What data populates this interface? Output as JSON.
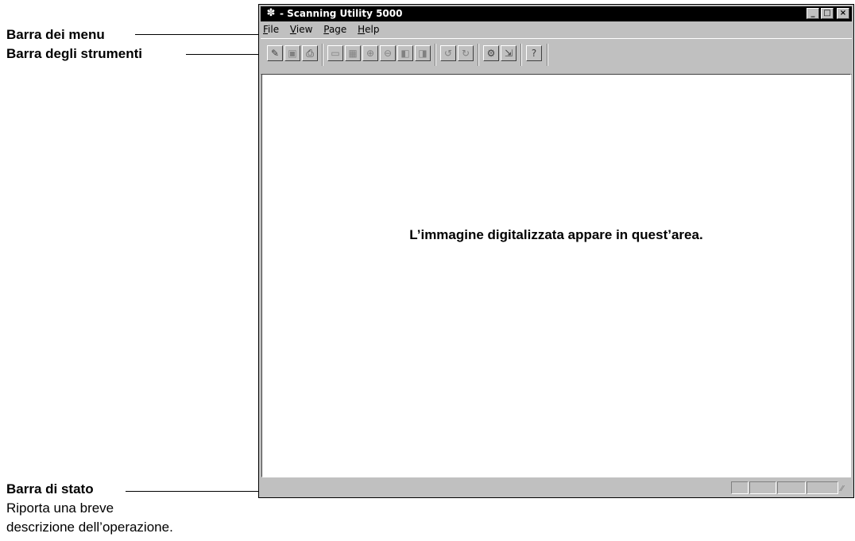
{
  "callouts": {
    "menu_bar": "Barra dei menu",
    "toolbar": "Barra degli strumenti",
    "status_bar": "Barra di stato",
    "status_desc_line1": "Riporta una breve",
    "status_desc_line2": "descrizione dell’operazione."
  },
  "window": {
    "title": "- Scanning Utility 5000",
    "minimize": "_",
    "maximize": "□",
    "close": "×",
    "app_icon": "scanner-app-icon"
  },
  "menu": {
    "items": [
      {
        "label": "File",
        "accel": "F"
      },
      {
        "label": "View",
        "accel": "V"
      },
      {
        "label": "Page",
        "accel": "P"
      },
      {
        "label": "Help",
        "accel": "H"
      }
    ]
  },
  "toolbar": {
    "buttons": [
      {
        "name": "acquire-icon",
        "glyph": "✎"
      },
      {
        "name": "save-icon",
        "glyph": "▣"
      },
      {
        "name": "print-icon",
        "glyph": "⎙"
      },
      {
        "name": "fit-page-icon",
        "glyph": "▭"
      },
      {
        "name": "fit-width-icon",
        "glyph": "▦"
      },
      {
        "name": "zoom-in-icon",
        "glyph": "⊕"
      },
      {
        "name": "zoom-out-icon",
        "glyph": "⊖"
      },
      {
        "name": "previous-page-icon",
        "glyph": "◧"
      },
      {
        "name": "next-page-icon",
        "glyph": "◨"
      },
      {
        "name": "rotate-left-icon",
        "glyph": "↺"
      },
      {
        "name": "rotate-right-icon",
        "glyph": "↻"
      },
      {
        "name": "scanner-settings-icon",
        "glyph": "⚙"
      },
      {
        "name": "send-icon",
        "glyph": "⇲"
      },
      {
        "name": "help-icon",
        "glyph": "?"
      }
    ]
  },
  "client": {
    "message": "L’immagine digitalizzata appare in quest’area."
  },
  "statusbar": {
    "text": ""
  }
}
